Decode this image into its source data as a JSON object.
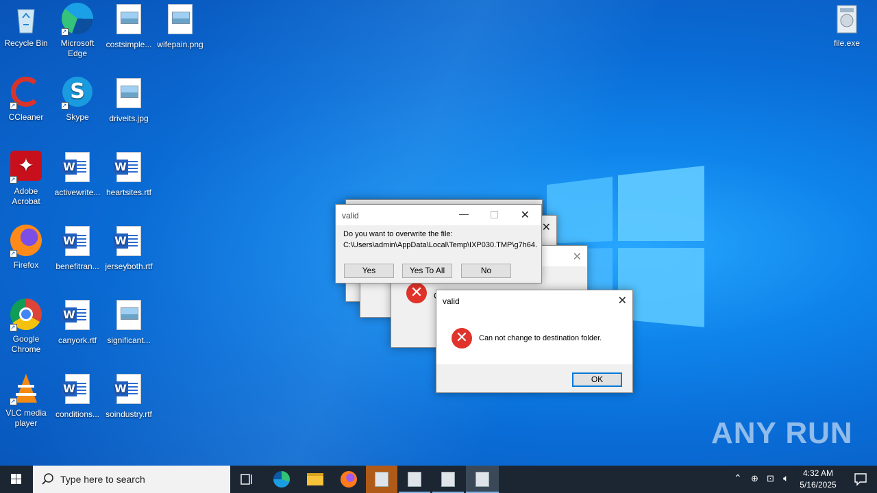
{
  "desktop": {
    "icons": [
      {
        "label": "Recycle Bin",
        "icon": "recycle-bin-icon"
      },
      {
        "label": "Microsoft Edge",
        "icon": "edge-icon"
      },
      {
        "label": "costsimple...",
        "icon": "image-file-icon"
      },
      {
        "label": "wifepain.png",
        "icon": "image-file-icon"
      },
      {
        "label": "CCleaner",
        "icon": "ccleaner-icon"
      },
      {
        "label": "Skype",
        "icon": "skype-icon"
      },
      {
        "label": "driveits.jpg",
        "icon": "image-file-icon"
      },
      {
        "label": "Adobe Acrobat",
        "icon": "acrobat-icon"
      },
      {
        "label": "activewrite...",
        "icon": "word-doc-icon"
      },
      {
        "label": "heartsites.rtf",
        "icon": "word-doc-icon"
      },
      {
        "label": "Firefox",
        "icon": "firefox-icon"
      },
      {
        "label": "benefitran...",
        "icon": "word-doc-icon"
      },
      {
        "label": "jerseyboth.rtf",
        "icon": "word-doc-icon"
      },
      {
        "label": "Google Chrome",
        "icon": "chrome-icon"
      },
      {
        "label": "canyork.rtf",
        "icon": "word-doc-icon"
      },
      {
        "label": "significant...",
        "icon": "image-file-icon"
      },
      {
        "label": "VLC media player",
        "icon": "vlc-icon"
      },
      {
        "label": "conditions...",
        "icon": "word-doc-icon"
      },
      {
        "label": "soindustry.rtf",
        "icon": "word-doc-icon"
      },
      {
        "label": "file.exe",
        "icon": "installer-exe-icon"
      }
    ]
  },
  "overwrite_dialog": {
    "title": "valid",
    "message_line1": "Do you want to overwrite the file:",
    "message_line2": "C:\\Users\\admin\\AppData\\Local\\Temp\\IXP030.TMP\\g7h64.",
    "buttons": {
      "yes": "Yes",
      "yes_to_all": "Yes To All",
      "no": "No"
    }
  },
  "error_dialog": {
    "title": "valid",
    "message": "Can not change to destination folder.",
    "ok": "OK"
  },
  "back_dialog_partial_text": "C",
  "taskbar": {
    "search_placeholder": "Type here to search",
    "time": "4:32 AM",
    "date": "5/16/2025"
  },
  "watermark": "ANY RUN",
  "colors": {
    "error_red": "#e0332b",
    "taskbar": "#1c2633",
    "desktop_blue": "#0a6cd6"
  }
}
